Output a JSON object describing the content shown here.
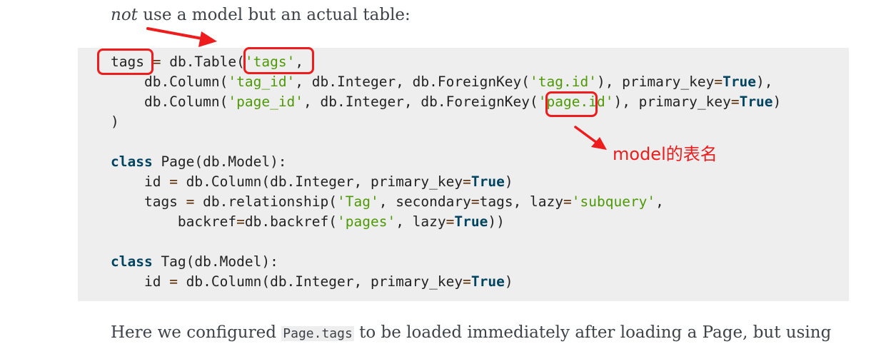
{
  "prose": {
    "top_em": "not",
    "top_rest": " use a model but an actual table:",
    "bottom_before": "Here we configured ",
    "bottom_code": "Page.tags",
    "bottom_after": " to be loaded immediately after loading a Page, but using"
  },
  "code": {
    "l1": {
      "a": "tags",
      "b": " ",
      "c": "=",
      "d": " db.Table(",
      "e": "'tags'",
      "f": ","
    },
    "l2": {
      "a": "    db.Column(",
      "b": "'tag_id'",
      "c": ", db.Integer, db.ForeignKey(",
      "d": "'tag.id'",
      "e": "), primary_key",
      "f": "=",
      "g": "True",
      "h": "),"
    },
    "l3": {
      "a": "    db.Column(",
      "b": "'page_id'",
      "c": ", db.Integer, db.ForeignKey(",
      "d": "'page.id'",
      "e": "), primary_key",
      "f": "=",
      "g": "True",
      "h": ")"
    },
    "l4": {
      "a": ")"
    },
    "l5": {
      "a": "class",
      "b": " Page(db.Model):"
    },
    "l6": {
      "a": "    id ",
      "b": "=",
      "c": " db.Column(db.Integer, primary_key",
      "d": "=",
      "e": "True",
      "f": ")"
    },
    "l7": {
      "a": "    tags ",
      "b": "=",
      "c": " db.relationship(",
      "d": "'Tag'",
      "e": ", secondary",
      "f": "=",
      "g": "tags, lazy",
      "h": "=",
      "i": "'subquery'",
      "j": ","
    },
    "l8": {
      "a": "        backref",
      "b": "=",
      "c": "db.backref(",
      "d": "'pages'",
      "e": ", lazy",
      "f": "=",
      "g": "True",
      "h": "))"
    },
    "l9": {
      "a": "class",
      "b": " Tag(db.Model):"
    },
    "l10": {
      "a": "    id ",
      "b": "=",
      "c": " db.Column(db.Integer, primary_key",
      "d": "=",
      "e": "True",
      "f": ")"
    }
  },
  "annotation": {
    "text": "model的表名",
    "color": "#ee1c1c"
  },
  "colors": {
    "keyword": "#004461",
    "string": "#4e9a06",
    "code_background": "#eeeeee",
    "highlight": "#ee1c1c"
  }
}
